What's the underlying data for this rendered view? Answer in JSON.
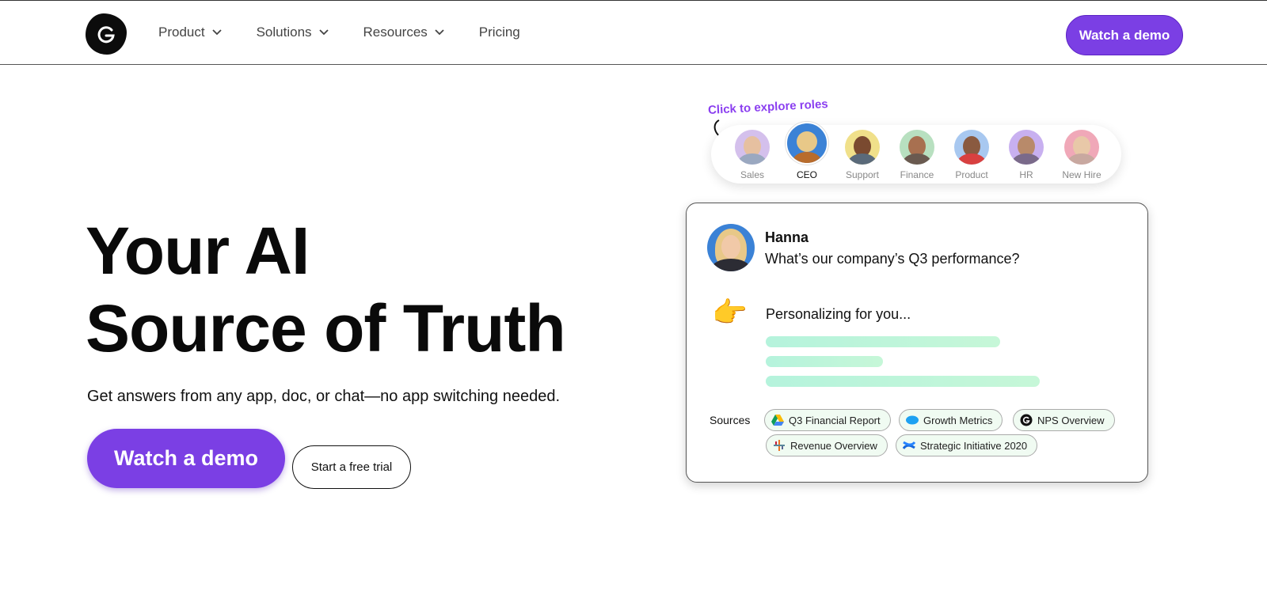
{
  "header": {
    "nav": [
      {
        "label": "Product",
        "has_dropdown": true
      },
      {
        "label": "Solutions",
        "has_dropdown": true
      },
      {
        "label": "Resources",
        "has_dropdown": true
      },
      {
        "label": "Pricing",
        "has_dropdown": false
      }
    ],
    "cta_label": "Watch a demo"
  },
  "hero": {
    "title_line1": "Your AI",
    "title_line2": "Source of Truth",
    "subtitle": "Get answers from any app, doc, or chat—no app switching needed.",
    "primary_cta": "Watch a demo",
    "secondary_cta": "Start a free trial"
  },
  "roles": {
    "hint": "Click to explore roles",
    "items": [
      {
        "label": "Sales",
        "active": false
      },
      {
        "label": "CEO",
        "active": true
      },
      {
        "label": "Support",
        "active": false
      },
      {
        "label": "Finance",
        "active": false
      },
      {
        "label": "Product",
        "active": false
      },
      {
        "label": "HR",
        "active": false
      },
      {
        "label": "New Hire",
        "active": false
      }
    ]
  },
  "card": {
    "user_name": "Hanna",
    "question": "What’s our company’s Q3 performance?",
    "emoji": "👉",
    "status": "Personalizing for you...",
    "sources_label": "Sources",
    "sources": [
      {
        "label": "Q3 Financial Report",
        "icon": "google-drive-icon"
      },
      {
        "label": "Growth Metrics",
        "icon": "salesforce-icon"
      },
      {
        "label": "NPS Overview",
        "icon": "glean-icon"
      },
      {
        "label": "Revenue Overview",
        "icon": "tableau-icon"
      },
      {
        "label": "Strategic Initiative 2020",
        "icon": "confluence-icon"
      }
    ]
  },
  "colors": {
    "accent": "#7b3fe4",
    "hint": "#8b3ff0",
    "skeleton": "#b5f3dc"
  }
}
